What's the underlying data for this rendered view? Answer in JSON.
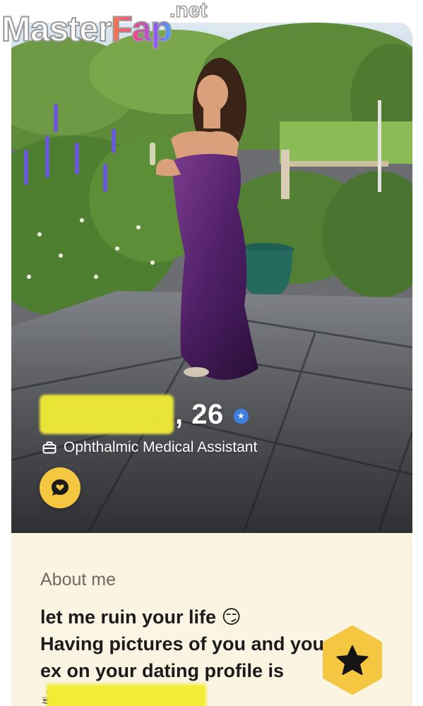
{
  "profile": {
    "age": ", 26",
    "job_title": "Ophthalmic Medical Assistant"
  },
  "about": {
    "label": "About me",
    "bio_lines": [
      "let me ruin your life 😏",
      "Having pictures of you and your",
      "ex on your dating profile is",
      "☕ 🐸"
    ]
  },
  "icons": {
    "verified": "verified-badge-icon",
    "job": "briefcase-icon",
    "compliment": "chat-heart-icon",
    "superswipe": "star-icon"
  },
  "colors": {
    "accent_yellow": "#f5c63f",
    "verified_blue": "#3f7fe0",
    "about_bg": "#fbf4e2"
  },
  "watermark": {
    "brand_a": "Master",
    "brand_b": "Fap",
    "brand_tld": ".net"
  }
}
